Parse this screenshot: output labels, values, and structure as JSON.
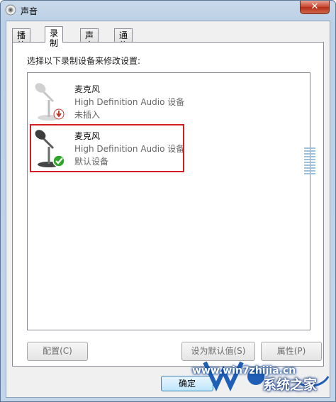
{
  "window": {
    "title": "声音"
  },
  "tabs": [
    {
      "label": "播放"
    },
    {
      "label": "录制",
      "active": true
    },
    {
      "label": "声音"
    },
    {
      "label": "通信"
    }
  ],
  "panel": {
    "prompt": "选择以下录制设备来修改设置:",
    "devices": [
      {
        "name": "麦克风",
        "driver": "High Definition Audio 设备",
        "status": "未插入",
        "status_icon": "down-arrow-icon"
      },
      {
        "name": "麦克风",
        "driver": "High Definition Audio 设备",
        "status": "默认设备",
        "status_icon": "check-icon"
      }
    ],
    "level": 0
  },
  "buttons": {
    "configure": "配置(C)",
    "set_default": "设为默认值(S)",
    "properties": "属性(P)",
    "ok": "确定"
  },
  "watermark": {
    "url": "www.win7zhijia.cn",
    "brand": "系统之家"
  },
  "colors": {
    "highlight": "#d41c23",
    "check": "#2ea52b",
    "unplugged": "#c0392b"
  }
}
